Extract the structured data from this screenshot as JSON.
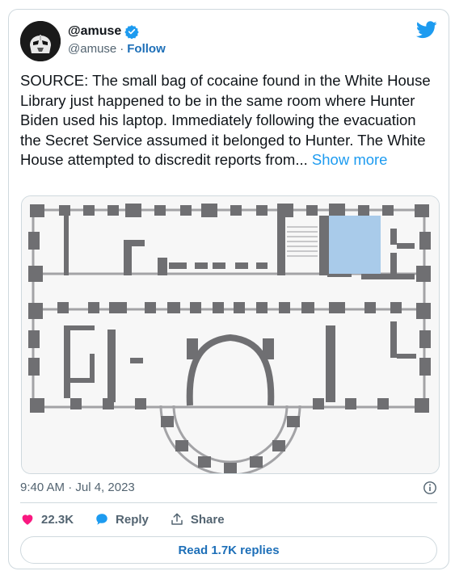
{
  "author": {
    "display_name": "@amuse",
    "handle": "@amuse",
    "separator": "·",
    "follow_label": "Follow",
    "verified_icon": "verified-badge-icon",
    "avatar_icon": "stormtrooper-avatar"
  },
  "tweet": {
    "text": "SOURCE: The small bag of cocaine found in the White House Library just happened to be in the same room where Hunter Biden used his laptop. Immediately following the evacuation the Secret Service assumed it belonged to Hunter. The White House attempted to discredit reports from...",
    "show_more": "Show more"
  },
  "meta": {
    "timestamp": "9:40 AM · Jul 4, 2023",
    "info_icon": "info-icon"
  },
  "actions": {
    "like_count": "22.3K",
    "reply_label": "Reply",
    "share_label": "Share"
  },
  "footer": {
    "read_replies": "Read 1.7K replies"
  },
  "colors": {
    "brand_blue": "#1d9bf0",
    "link_blue": "#1d6fb8",
    "heart_red": "#f91880",
    "highlight_room": "#a9cbea",
    "wall_gray": "#6f6f72"
  }
}
